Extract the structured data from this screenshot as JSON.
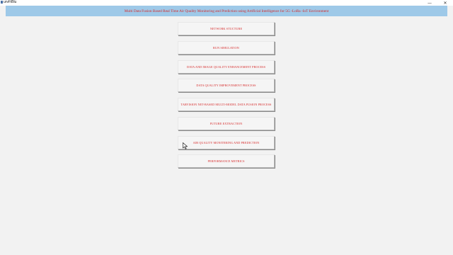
{
  "window": {
    "title": "urvFiBlu",
    "minimize_glyph": "—",
    "close_glyph": "✕"
  },
  "header": {
    "title": "Multi Data Fusion Based Real Time Air Quality Monitoring and Prediction using Artificial Intelligence for 5G -LoRa -IoT Environment"
  },
  "menu": {
    "buttons": [
      {
        "label": "NETWORK STUCTURE"
      },
      {
        "label": "RUN SIMULATION"
      },
      {
        "label": "DATA AND IMAGE QUALITY ENHANCEMENT PROCESS"
      },
      {
        "label": "DATA QUALITY IMPROVEMENT PROCESS"
      },
      {
        "label": "TARVISION NET-BASED MULTI-MODEL DATA FUSION PROCESS"
      },
      {
        "label": "FUTURE EXTRACTION"
      },
      {
        "label": "AIR QUALITY MONITERING AND PREDICTION"
      },
      {
        "label": "PERFORMANCE METRICS"
      }
    ]
  },
  "colors": {
    "banner": "#9ec9e8",
    "text_accent": "#d62b2b",
    "background": "#f2f2f2"
  },
  "icons": {
    "cursor": "mouse-pointer-icon",
    "app": "app-icon"
  }
}
